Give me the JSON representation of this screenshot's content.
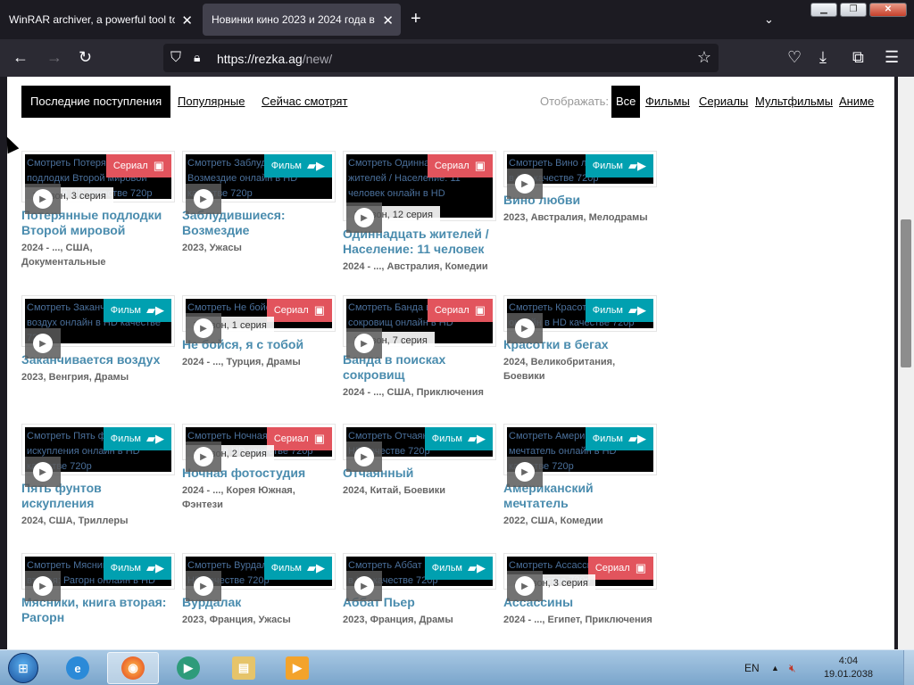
{
  "browser": {
    "tabs": [
      {
        "title": "WinRAR archiver, a powerful tool to",
        "active": false
      },
      {
        "title": "Новинки кино 2023 и 2024 года в",
        "active": true
      }
    ],
    "new_tab_icon": "plus-icon",
    "url_host": "https://rezka.ag",
    "url_path": "/new/"
  },
  "filters": {
    "tabs": [
      "Последние поступления",
      "Популярные",
      "Сейчас смотрят"
    ],
    "show_label": "Отображать:",
    "types": [
      "Все",
      "Фильмы",
      "Сериалы",
      "Мультфильмы",
      "Аниме"
    ]
  },
  "cards": [
    {
      "alt": "Смотреть Потерянные подлодки Второй мировой онлайн в HD качестве 720p",
      "badge": "Сериал",
      "episode": "1 сезон, 3 серия",
      "title": "Потерянные подлодки Второй мировой",
      "info": "2024 - ..., США, Документальные"
    },
    {
      "alt": "Смотреть Заблудившиеся: Возмездие онлайн в HD качестве 720p",
      "badge": "Фильм",
      "episode": "",
      "title": "Заблудившиеся: Возмездие",
      "info": "2023, Ужасы"
    },
    {
      "alt": "Смотреть Одиннадцать жителей / Население: 11 человек онлайн в HD",
      "badge": "Сериал",
      "episode": "1 сезон, 12 серия",
      "title": "Одиннадцать жителей / Население: 11 человек",
      "info": "2024 - ..., Австралия, Комедии"
    },
    {
      "alt": "Смотреть Вино любви онлайн в HD качестве 720p",
      "badge": "Фильм",
      "episode": "",
      "title": "Вино любви",
      "info": "2023, Австралия, Мелодрамы"
    },
    {
      "alt": "Смотреть Заканчивается воздух онлайн в HD качестве 720p",
      "badge": "Фильм",
      "episode": "",
      "title": "Заканчивается воздух",
      "info": "2023, Венгрия, Драмы"
    },
    {
      "alt": "Смотреть Не бойся, я с тобой",
      "badge": "Сериал",
      "episode": "1 сезон, 1 серия",
      "title": "Не бойся, я с тобой",
      "info": "2024 - ..., Турция, Драмы"
    },
    {
      "alt": "Смотреть Банда в поисках сокровищ онлайн в HD",
      "badge": "Сериал",
      "episode": "1 сезон, 7 серия",
      "title": "Банда в поисках сокровищ",
      "info": "2024 - ..., США, Приключения"
    },
    {
      "alt": "Смотреть Красотки в бегах онлайн в HD качестве 720p",
      "badge": "Фильм",
      "episode": "",
      "title": "Красотки в бегах",
      "info": "2024, Великобритания, Боевики"
    },
    {
      "alt": "Смотреть Пять фунтов искупления онлайн в HD качестве 720p",
      "badge": "Фильм",
      "episode": "",
      "title": "Пять фунтов искупления",
      "info": "2024, США, Триллеры"
    },
    {
      "alt": "Смотреть Ночная фотостудия онлайн в HD качестве 720p",
      "badge": "Сериал",
      "episode": "1 сезон, 2 серия",
      "title": "Ночная фотостудия",
      "info": "2024 - ..., Корея Южная, Фэнтези"
    },
    {
      "alt": "Смотреть Отчаянный онлайн в HD качестве 720p",
      "badge": "Фильм",
      "episode": "",
      "title": "Отчаянный",
      "info": "2024, Китай, Боевики"
    },
    {
      "alt": "Смотреть Американский мечтатель онлайн в HD качестве 720p",
      "badge": "Фильм",
      "episode": "",
      "title": "Американский мечтатель",
      "info": "2022, США, Комедии"
    },
    {
      "alt": "Смотреть Мясники, книга вторая: Рагорн онлайн в HD качестве 720p",
      "badge": "Фильм",
      "episode": "",
      "title": "Мясники, книга вторая: Рагорн",
      "info": ""
    },
    {
      "alt": "Смотреть Вурдалак онлайн в HD качестве 720p",
      "badge": "Фильм",
      "episode": "",
      "title": "Вурдалак",
      "info": "2023, Франция, Ужасы"
    },
    {
      "alt": "Смотреть Аббат Пьер онлайн в HD качестве 720p",
      "badge": "Фильм",
      "episode": "",
      "title": "Аббат Пьер",
      "info": "2023, Франция, Драмы"
    },
    {
      "alt": "Смотреть Ассассины онлайн в HD качестве 720p",
      "badge": "Сериал",
      "episode": "4 сезон, 3 серия",
      "title": "Ассассины",
      "info": "2024 - ..., Египет, Приключения"
    }
  ],
  "taskbar": {
    "lang": "EN",
    "time": "4:04",
    "date": "19.01.2038"
  }
}
